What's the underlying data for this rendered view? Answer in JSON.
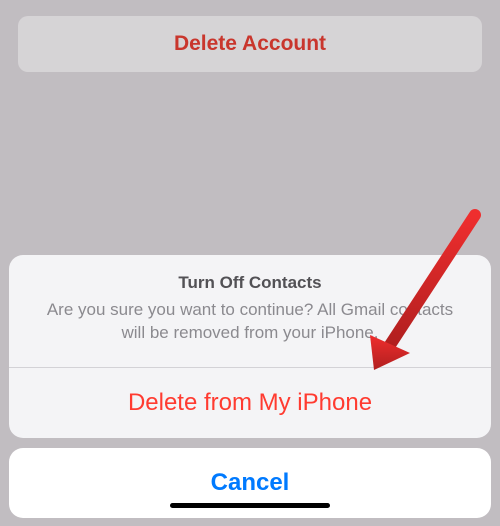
{
  "top": {
    "delete_account_label": "Delete Account"
  },
  "sheet": {
    "title": "Turn Off Contacts",
    "message": "Are you sure you want to continue? All Gmail contacts will be removed from your iPhone.",
    "destructive_label": "Delete from My iPhone",
    "cancel_label": "Cancel"
  }
}
